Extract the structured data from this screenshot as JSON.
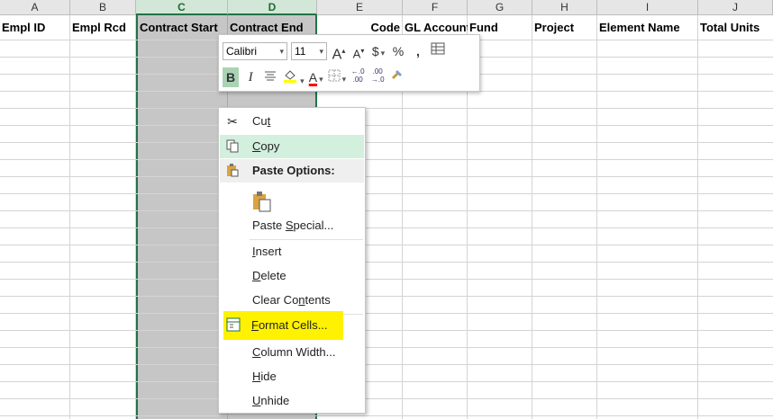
{
  "columns": [
    {
      "letter": "A",
      "header": "Empl ID"
    },
    {
      "letter": "B",
      "header": "Empl Rcd"
    },
    {
      "letter": "C",
      "header": "Contract Start"
    },
    {
      "letter": "D",
      "header": "Contract End"
    },
    {
      "letter": "E",
      "header": "Code"
    },
    {
      "letter": "F",
      "header": "GL Account"
    },
    {
      "letter": "G",
      "header": "Fund"
    },
    {
      "letter": "H",
      "header": "Project"
    },
    {
      "letter": "I",
      "header": "Element Name"
    },
    {
      "letter": "J",
      "header": "Total Units"
    }
  ],
  "mini_toolbar": {
    "font_name": "Calibri",
    "font_size": "11",
    "grow_font": "A",
    "shrink_font": "A",
    "currency": "$",
    "percent": "%",
    "comma": ",",
    "bold": "B",
    "italic": "I",
    "font_color_letter": "A",
    "inc_decimal": "←.0\n.00",
    "dec_decimal": ".00\n→.0",
    "accent_color": "#217346",
    "fill_color": "#ffff00",
    "font_color": "#ff0000"
  },
  "context_menu": {
    "cut": {
      "pre": "Cu",
      "u": "t",
      "post": ""
    },
    "copy": {
      "pre": "",
      "u": "C",
      "post": "opy"
    },
    "paste_options": "Paste Options:",
    "paste_special": {
      "pre": "Paste ",
      "u": "S",
      "post": "pecial..."
    },
    "insert": {
      "pre": "",
      "u": "I",
      "post": "nsert"
    },
    "delete": {
      "pre": "",
      "u": "D",
      "post": "elete"
    },
    "clear_contents": {
      "pre": "Clear Co",
      "u": "n",
      "post": "tents"
    },
    "format_cells": {
      "pre": "",
      "u": "F",
      "post": "ormat Cells..."
    },
    "column_width": {
      "pre": "",
      "u": "C",
      "post": "olumn Width..."
    },
    "hide": {
      "pre": "",
      "u": "H",
      "post": "ide"
    },
    "unhide": {
      "pre": "",
      "u": "U",
      "post": "nhide"
    },
    "highlight_color": "#fff200"
  }
}
